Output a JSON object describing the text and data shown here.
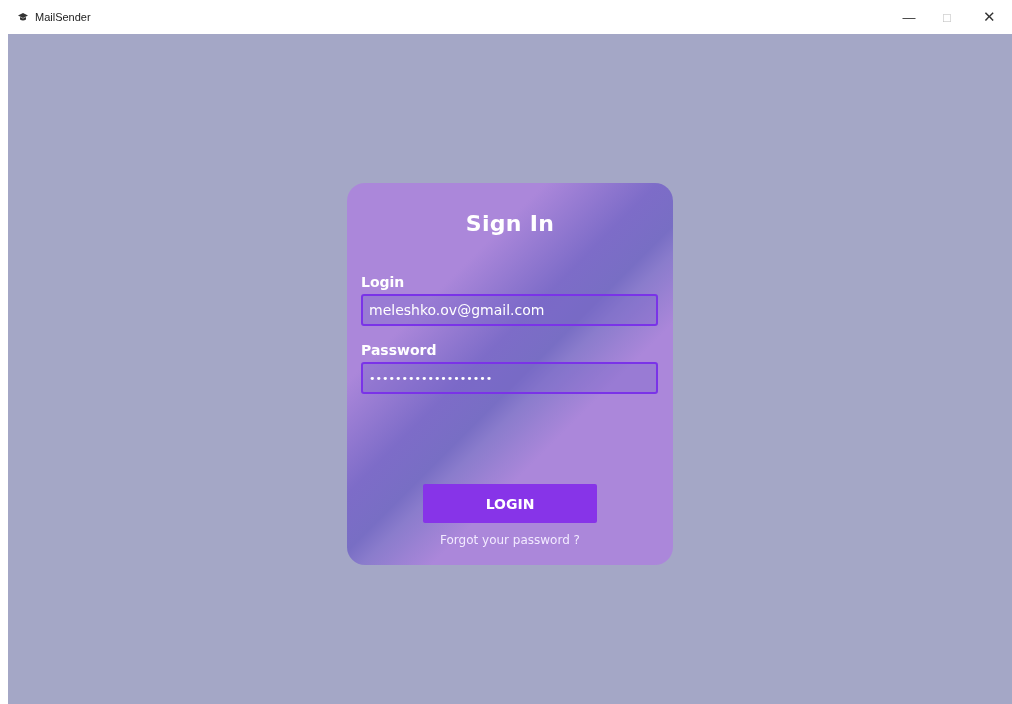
{
  "window": {
    "title": "MailSender",
    "controls": [
      "—",
      "□",
      "✕"
    ]
  },
  "form": {
    "title": "Sign In",
    "fields": [
      {
        "label": "Login",
        "value": "meleshko.ov@gmail.com",
        "kind": "text"
      },
      {
        "label": "Password",
        "value": "•••••••••••••••••••",
        "kind": "password"
      }
    ],
    "button": "LOGIN",
    "link": "Forgot your password ?"
  }
}
